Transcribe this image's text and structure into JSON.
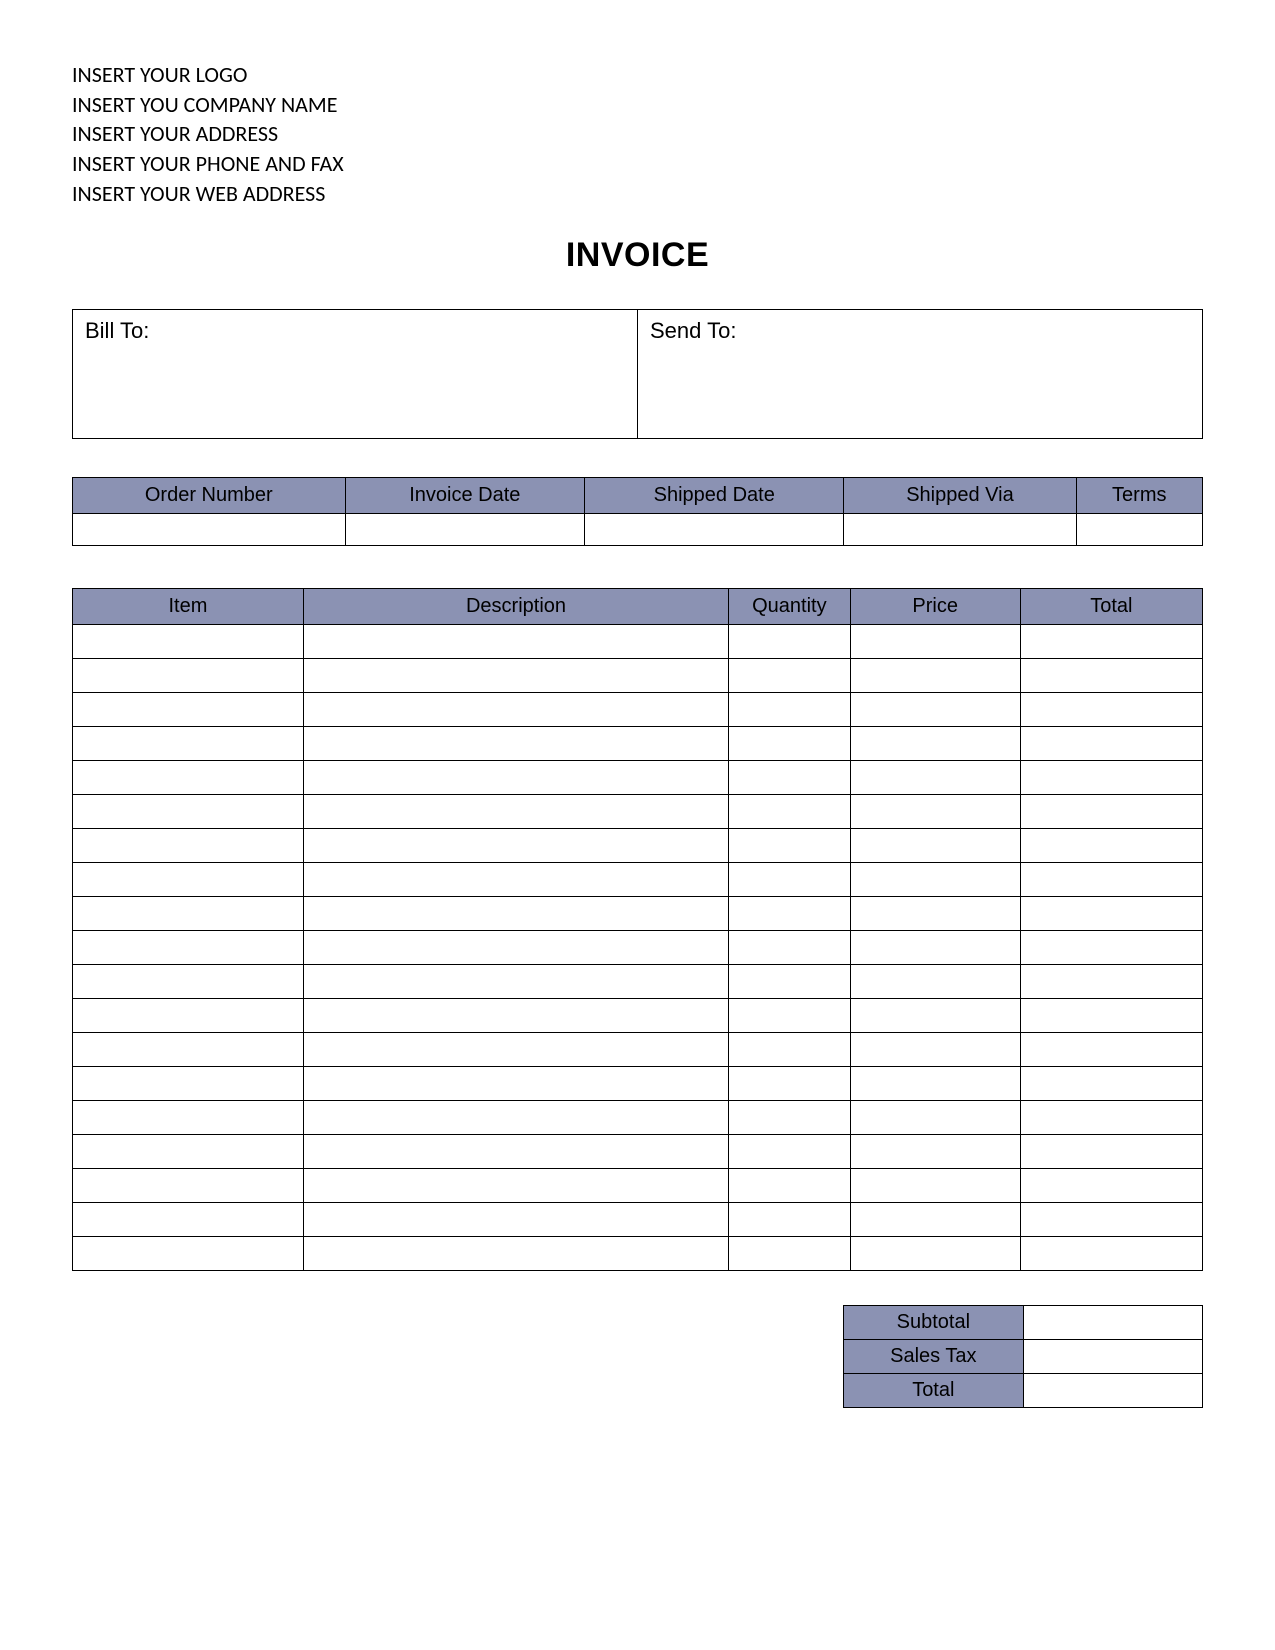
{
  "company": {
    "logo_line": "INSERT YOUR LOGO",
    "name_line": "INSERT YOU COMPANY NAME",
    "address_line": "INSERT YOUR ADDRESS",
    "phone_line": "INSERT YOUR PHONE AND FAX",
    "web_line": "INSERT YOUR WEB ADDRESS"
  },
  "title": "INVOICE",
  "address": {
    "bill_to_label": "Bill To:",
    "bill_to_value": "",
    "send_to_label": "Send To:",
    "send_to_value": ""
  },
  "order_headers": {
    "order_number": "Order Number",
    "invoice_date": "Invoice Date",
    "shipped_date": "Shipped Date",
    "shipped_via": "Shipped Via",
    "terms": "Terms"
  },
  "order_values": {
    "order_number": "",
    "invoice_date": "",
    "shipped_date": "",
    "shipped_via": "",
    "terms": ""
  },
  "item_headers": {
    "item": "Item",
    "description": "Description",
    "quantity": "Quantity",
    "price": "Price",
    "total": "Total"
  },
  "items": [
    {
      "item": "",
      "description": "",
      "quantity": "",
      "price": "",
      "total": ""
    },
    {
      "item": "",
      "description": "",
      "quantity": "",
      "price": "",
      "total": ""
    },
    {
      "item": "",
      "description": "",
      "quantity": "",
      "price": "",
      "total": ""
    },
    {
      "item": "",
      "description": "",
      "quantity": "",
      "price": "",
      "total": ""
    },
    {
      "item": "",
      "description": "",
      "quantity": "",
      "price": "",
      "total": ""
    },
    {
      "item": "",
      "description": "",
      "quantity": "",
      "price": "",
      "total": ""
    },
    {
      "item": "",
      "description": "",
      "quantity": "",
      "price": "",
      "total": ""
    },
    {
      "item": "",
      "description": "",
      "quantity": "",
      "price": "",
      "total": ""
    },
    {
      "item": "",
      "description": "",
      "quantity": "",
      "price": "",
      "total": ""
    },
    {
      "item": "",
      "description": "",
      "quantity": "",
      "price": "",
      "total": ""
    },
    {
      "item": "",
      "description": "",
      "quantity": "",
      "price": "",
      "total": ""
    },
    {
      "item": "",
      "description": "",
      "quantity": "",
      "price": "",
      "total": ""
    },
    {
      "item": "",
      "description": "",
      "quantity": "",
      "price": "",
      "total": ""
    },
    {
      "item": "",
      "description": "",
      "quantity": "",
      "price": "",
      "total": ""
    },
    {
      "item": "",
      "description": "",
      "quantity": "",
      "price": "",
      "total": ""
    },
    {
      "item": "",
      "description": "",
      "quantity": "",
      "price": "",
      "total": ""
    },
    {
      "item": "",
      "description": "",
      "quantity": "",
      "price": "",
      "total": ""
    },
    {
      "item": "",
      "description": "",
      "quantity": "",
      "price": "",
      "total": ""
    },
    {
      "item": "",
      "description": "",
      "quantity": "",
      "price": "",
      "total": ""
    }
  ],
  "summary": {
    "subtotal_label": "Subtotal",
    "subtotal_value": "",
    "salestax_label": "Sales Tax",
    "salestax_value": "",
    "total_label": "Total",
    "total_value": ""
  },
  "colors": {
    "header_bg": "#8b92b3"
  }
}
